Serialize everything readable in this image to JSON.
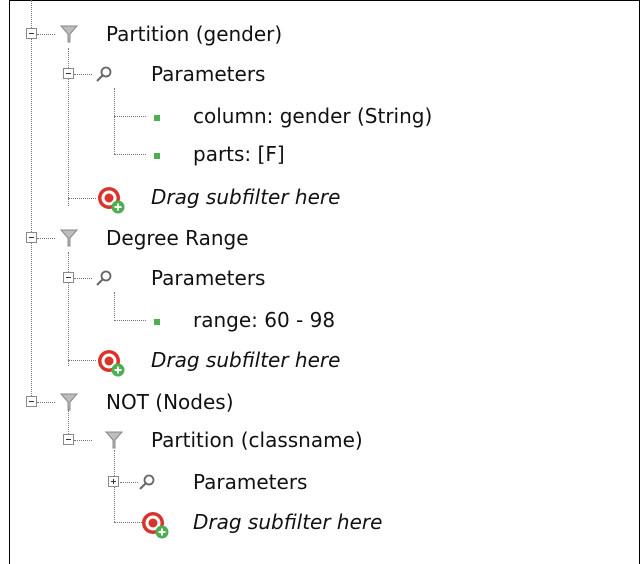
{
  "tree": {
    "nodes": [
      {
        "label": "Partition (gender)",
        "icon": "filter-icon"
      },
      {
        "label": "Parameters",
        "icon": "parameters-icon"
      },
      {
        "label": "column: gender (String)",
        "icon": "parameter-dot-icon"
      },
      {
        "label": "parts: [F]",
        "icon": "parameter-dot-icon"
      },
      {
        "label": "Drag subfilter here",
        "icon": "target-add-icon"
      },
      {
        "label": "Degree Range",
        "icon": "filter-icon"
      },
      {
        "label": "Parameters",
        "icon": "parameters-icon"
      },
      {
        "label": "range: 60 - 98",
        "icon": "parameter-dot-icon"
      },
      {
        "label": "Drag subfilter here",
        "icon": "target-add-icon"
      },
      {
        "label": "NOT (Nodes)",
        "icon": "filter-icon"
      },
      {
        "label": "Partition (classname)",
        "icon": "filter-icon"
      },
      {
        "label": "Parameters",
        "icon": "parameters-icon"
      },
      {
        "label": "Drag subfilter here",
        "icon": "target-add-icon"
      }
    ],
    "colors": {
      "accent_green": "#4caf50",
      "target_red": "#d9342b",
      "dotted_line": "#777777"
    }
  }
}
